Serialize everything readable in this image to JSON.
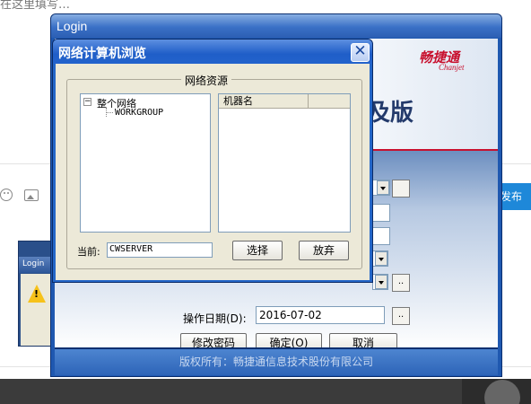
{
  "background_page": {
    "top_text": "在这里填写…",
    "publish_label": "发布"
  },
  "small_login": {
    "title": "Login",
    "warning_mark": "!"
  },
  "login_window": {
    "title": "Login",
    "brand_cn": "畅捷通",
    "brand_en": "Chanjet",
    "edition_text": "及版",
    "op_date_label": "操作日期(D):",
    "op_date_value": "2016-07-02",
    "browse_btn": "..",
    "change_password_btn": "修改密码",
    "ok_btn": "确定(O)",
    "cancel_btn": "取消",
    "copyright": "版权所有：畅捷通信息技术股份有限公司"
  },
  "network_dialog": {
    "title": "网络计算机浏览",
    "close_symbol": "✕",
    "group_label": "网络资源",
    "tree": {
      "toggle": "−",
      "root": "整个网络",
      "child": "WORKGROUP"
    },
    "list": {
      "column_name": "机器名",
      "column_extra": ""
    },
    "current_label": "当前:",
    "current_value": "CWSERVER",
    "select_btn": "选择",
    "abandon_btn": "放弃"
  }
}
